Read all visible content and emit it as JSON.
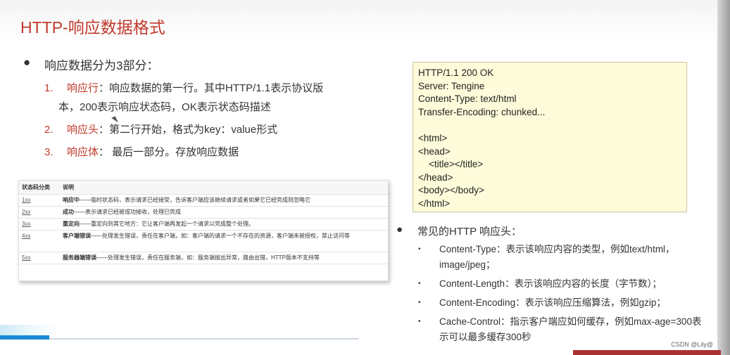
{
  "title": "HTTP-响应数据格式",
  "main_bullet": {
    "dot": "●",
    "text": "响应数据分为3部分："
  },
  "numbered_items": [
    {
      "num": "1.",
      "key": "响应行",
      "text": "：响应数据的第一行。其中HTTP/1.1表示协议版",
      "cont": "本，200表示响应状态码，OK表示状态码描述"
    },
    {
      "num": "2.",
      "key": "响应头",
      "text": "：第二行开始，格式为key：value形式",
      "cont": ""
    },
    {
      "num": "3.",
      "key": "响应体",
      "text": "： 最后一部分。存放响应数据",
      "cont": ""
    }
  ],
  "status_table": {
    "headers": [
      "状态码分类",
      "说明"
    ],
    "rows": [
      {
        "code": "1xx",
        "name": "响应中",
        "desc": "——临时状态码，表示请求已经接受，告诉客户端应该继续请求或者如果它已经完成则忽略它"
      },
      {
        "code": "2xx",
        "name": "成功",
        "desc": "——表示请求已经被成功接收，处理已完成"
      },
      {
        "code": "3xx",
        "name": "重定向",
        "desc": "——重定向到其它地方：它让客户端再发起一个请求以完成整个处理。"
      },
      {
        "code": "4xx",
        "name": "客户端错误",
        "desc": "——处理发生错误，责任在客户端，如：客户端的请求一个不存在的资源，客户端未被授权，禁止访问等"
      },
      {
        "code": "5xx",
        "name": "服务器端错误",
        "desc": "——处理发生错误，责任在服务端，如：服务端抛出异常，路由出错，HTTP版本不支持等"
      }
    ]
  },
  "code_lines": [
    "HTTP/1.1 200 OK",
    "Server: Tengine",
    "Content-Type: text/html",
    "Transfer-Encoding: chunked...",
    "",
    "<html>",
    "<head>",
    "    <title></title>",
    "</head>",
    "<body></body>",
    "</html>"
  ],
  "headers_bullet": {
    "dot": "●",
    "text": "常见的HTTP 响应头："
  },
  "header_items": [
    {
      "dot": "•",
      "text": "Content-Type：表示该响应内容的类型，例如text/html，image/jpeg；"
    },
    {
      "dot": "•",
      "text": "Content-Length：表示该响应内容的长度（字节数）；"
    },
    {
      "dot": "•",
      "text": "Content-Encoding：表示该响应压缩算法，例如gzip；"
    },
    {
      "dot": "•",
      "text": "Cache-Control：指示客户端应如何缓存，例如max-age=300表示可以最多缓存300秒"
    }
  ],
  "watermark": "CSDN @Lily@",
  "colors": {
    "accent": "#c0392b",
    "code_bg": "#fdfbd9",
    "bar_blue": "#1a8ad4"
  }
}
